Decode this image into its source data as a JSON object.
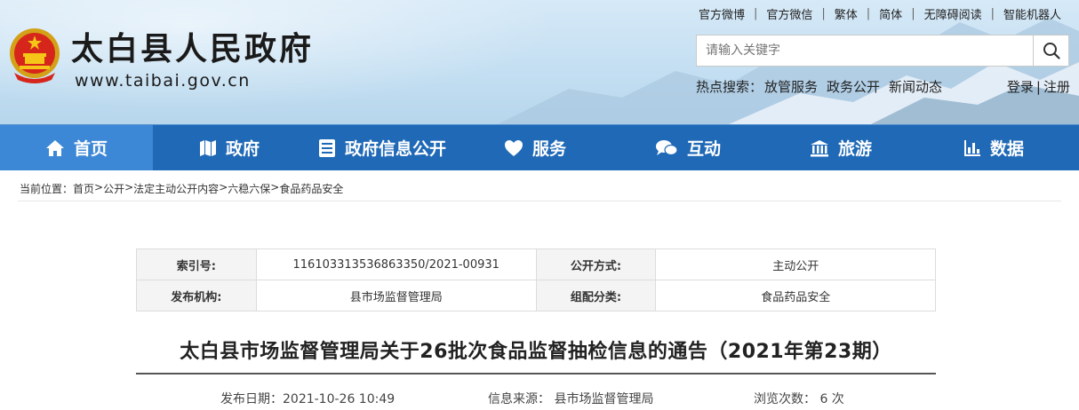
{
  "top_links": [
    "官方微博",
    "官方微信",
    "繁体",
    "简体",
    "无障碍阅读",
    "智能机器人"
  ],
  "site": {
    "title": "太白县人民政府",
    "url": "www.taibai.gov.cn"
  },
  "search": {
    "placeholder": "请输入关键字"
  },
  "hot_search": {
    "label": "热点搜索：",
    "items": [
      "放管服务",
      "政务公开",
      "新闻动态"
    ]
  },
  "auth": {
    "login": "登录",
    "logout": "注册"
  },
  "nav": [
    {
      "label": "首页",
      "icon": "home-icon"
    },
    {
      "label": "政府",
      "icon": "map-icon"
    },
    {
      "label": "政府信息公开",
      "icon": "list-icon"
    },
    {
      "label": "服务",
      "icon": "heart-icon"
    },
    {
      "label": "互动",
      "icon": "chat-icon"
    },
    {
      "label": "旅游",
      "icon": "building-icon"
    },
    {
      "label": "数据",
      "icon": "bar-chart-icon"
    }
  ],
  "breadcrumb": {
    "label": "当前位置：",
    "items": [
      "首页",
      "公开",
      "法定主动公开内容",
      "六稳六保",
      "食品药品安全"
    ],
    "sep": ">"
  },
  "info": {
    "index_label": "索引号:",
    "index_value": "116103313536863350/2021-00931",
    "public_label": "公开方式:",
    "public_value": "主动公开",
    "org_label": "发布机构:",
    "org_value": "县市场监督管理局",
    "category_label": "组配分类:",
    "category_value": "食品药品安全"
  },
  "article": {
    "title": "太白县市场监督管理局关于26批次食品监督抽检信息的通告（2021年第23期）",
    "date": "发布日期：2021-10-26 10:49",
    "source": "信息来源： 县市场监督管理局",
    "views": "浏览次数： 6 次"
  },
  "colors": {
    "nav_bg": "#1f69b7",
    "nav_active": "#3d88d6",
    "title_red": "#c00000"
  }
}
